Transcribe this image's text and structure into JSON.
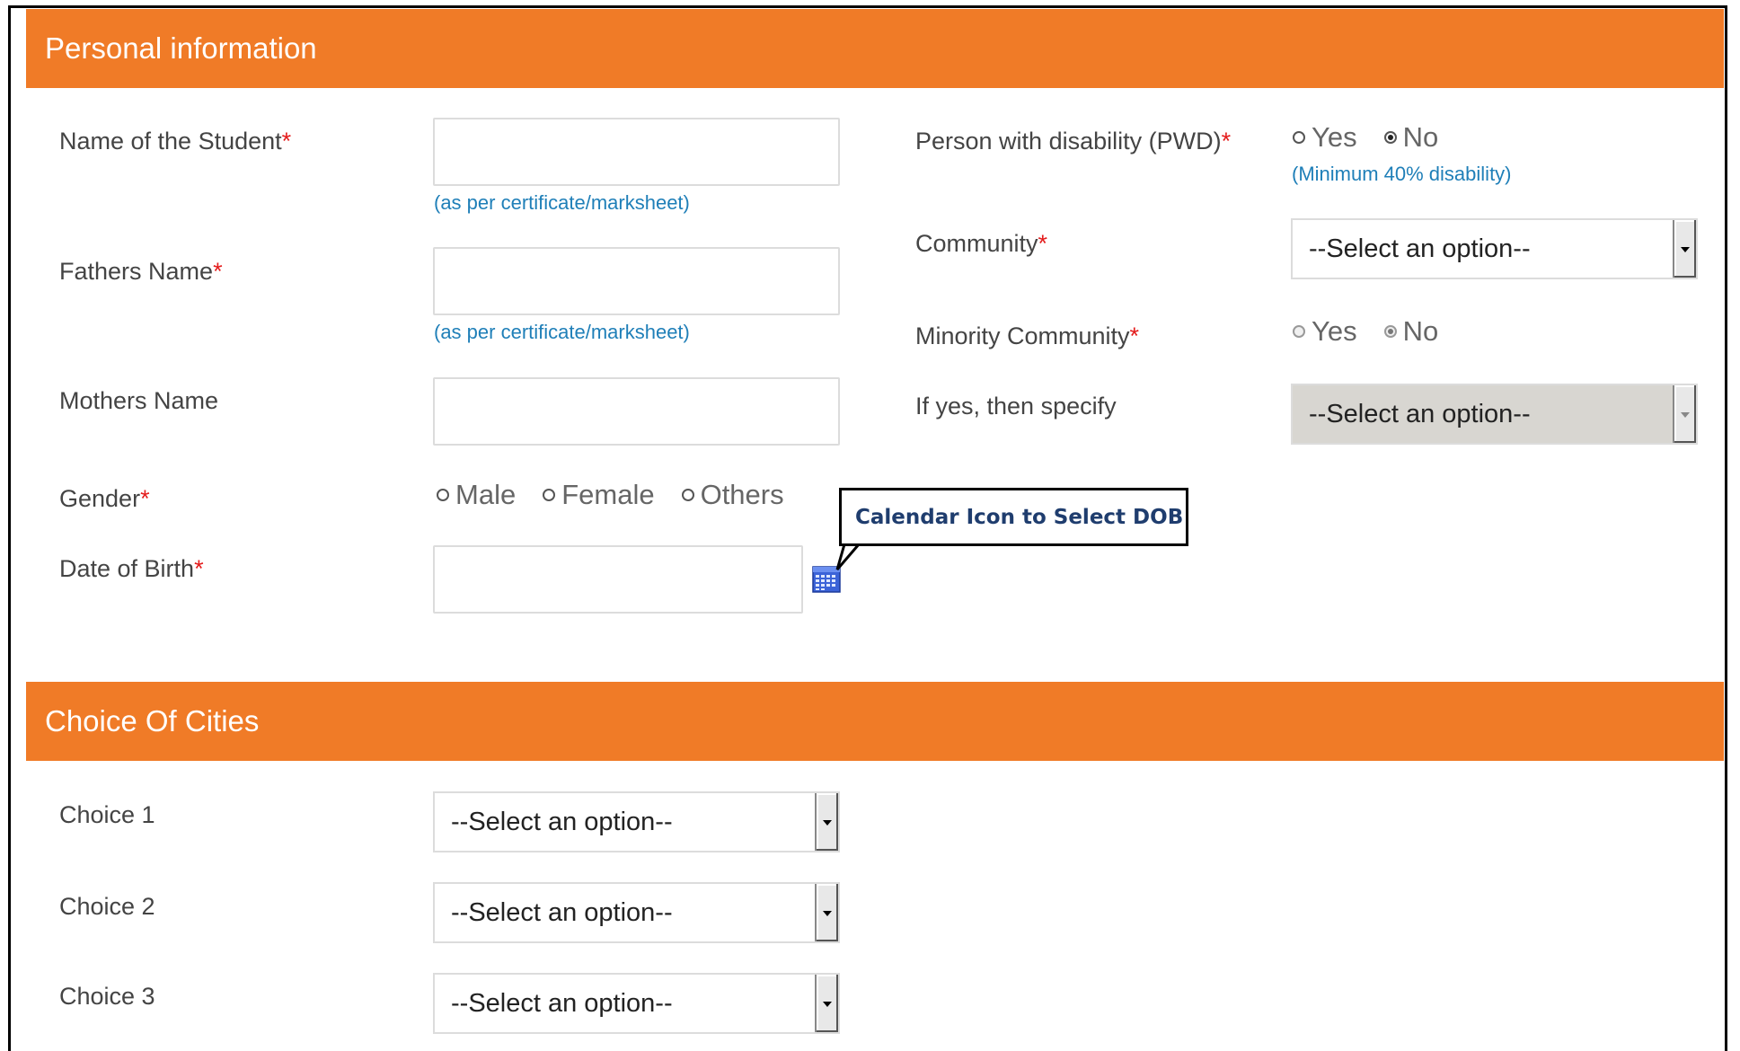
{
  "personal": {
    "title": "Personal information",
    "name_label": "Name of the Student",
    "name_hint": "(as per certificate/marksheet)",
    "father_label": "Fathers Name",
    "father_hint": "(as per certificate/marksheet)",
    "mother_label": "Mothers Name",
    "gender_label": "Gender",
    "gender_options": [
      "Male",
      "Female",
      "Others"
    ],
    "dob_label": "Date of Birth",
    "required_mark": "*",
    "pwd_label": "Person with disability (PWD)",
    "pwd_options": [
      "Yes",
      "No"
    ],
    "pwd_selected": "No",
    "pwd_hint": "(Minimum 40% disability)",
    "community_label": "Community",
    "community_value": "--Select an option--",
    "minority_label": "Minority Community",
    "minority_options": [
      "Yes",
      "No"
    ],
    "minority_selected": "No",
    "specify_label": "If yes, then specify",
    "specify_value": "--Select an option--"
  },
  "callout": {
    "text": "Calendar Icon to Select DOB"
  },
  "cities": {
    "title": "Choice Of Cities",
    "choices": [
      {
        "label": "Choice 1",
        "value": "--Select an option--"
      },
      {
        "label": "Choice 2",
        "value": "--Select an option--"
      },
      {
        "label": "Choice 3",
        "value": "--Select an option--"
      }
    ]
  },
  "colors": {
    "accent": "#f07b27",
    "required": "#e41c1c",
    "hint": "#1f7fb8",
    "callout_text": "#1f3d6e"
  },
  "icons": {
    "calendar": "calendar-icon"
  }
}
